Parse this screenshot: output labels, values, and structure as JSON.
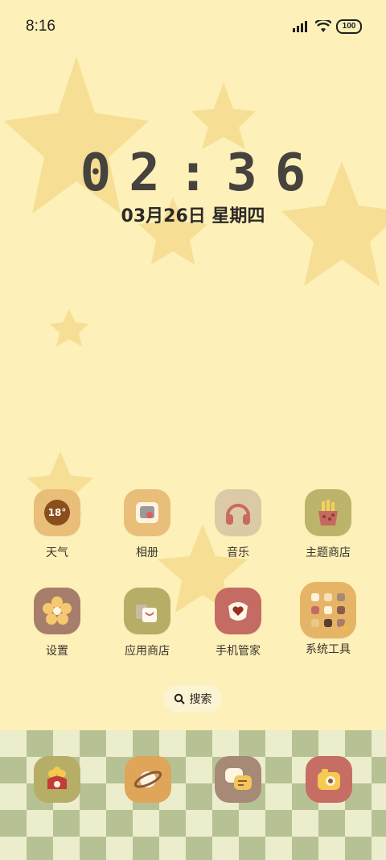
{
  "status_bar": {
    "time": "8:16",
    "battery": "100",
    "icons": [
      "signal-icon",
      "wifi-icon",
      "battery-icon"
    ]
  },
  "lock_clock": {
    "time": "02:36",
    "date": "03月26日 星期四"
  },
  "weather_widget": {
    "temperature": "18°"
  },
  "apps_row1": [
    {
      "label": "天气",
      "icon": "weather-icon",
      "color": "#e8be78"
    },
    {
      "label": "相册",
      "icon": "photo-icon",
      "color": "#e8be78"
    },
    {
      "label": "音乐",
      "icon": "headphones-icon",
      "color": "#dccaa6"
    },
    {
      "label": "主题商店",
      "icon": "fries-icon",
      "color": "#bcb46a"
    }
  ],
  "apps_row2": [
    {
      "label": "设置",
      "icon": "flower-icon",
      "color": "#a77d6b"
    },
    {
      "label": "应用商店",
      "icon": "shopping-bag-icon",
      "color": "#b6ad66"
    },
    {
      "label": "手机管家",
      "icon": "shield-heart-icon",
      "color": "#c46b63"
    },
    {
      "label": "系统工具",
      "icon": "folder-icon",
      "color": "#e6b466"
    }
  ],
  "search": {
    "label": "搜索"
  },
  "dock": [
    {
      "name": "phone",
      "icon": "phone-icon",
      "color": "#b6ad66"
    },
    {
      "name": "browser",
      "icon": "planet-icon",
      "color": "#dfa559"
    },
    {
      "name": "messages",
      "icon": "chat-icon",
      "color": "#a68a75"
    },
    {
      "name": "camera",
      "icon": "camera-icon",
      "color": "#c66d64"
    }
  ]
}
